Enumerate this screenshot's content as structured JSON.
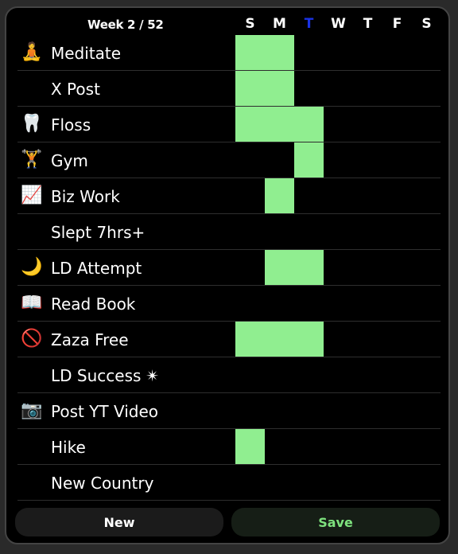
{
  "header": {
    "week_label": "Week 2 / 52",
    "days": [
      "S",
      "M",
      "T",
      "W",
      "T",
      "F",
      "S"
    ],
    "today_index": 2,
    "today_color": "#1a33e6"
  },
  "habits": [
    {
      "name": "Meditate",
      "icon": "🧘",
      "icon_name": "meditation-icon",
      "done": [
        1,
        1,
        0,
        0,
        0,
        0,
        0
      ]
    },
    {
      "name": "X Post",
      "icon": "🗣",
      "icon_name": "speaking-head-icon",
      "done": [
        1,
        1,
        0,
        0,
        0,
        0,
        0
      ]
    },
    {
      "name": "Floss",
      "icon": "🦷",
      "icon_name": "tooth-icon",
      "done": [
        1,
        1,
        1,
        0,
        0,
        0,
        0
      ]
    },
    {
      "name": "Gym",
      "icon": "🏋",
      "icon_name": "weightlifter-icon",
      "done": [
        0,
        0,
        1,
        0,
        0,
        0,
        0
      ]
    },
    {
      "name": "Biz Work",
      "icon": "📈",
      "icon_name": "chart-increasing-icon",
      "done": [
        0,
        1,
        0,
        0,
        0,
        0,
        0
      ]
    },
    {
      "name": "Slept 7hrs+",
      "icon": "😴",
      "icon_name": "sleeping-face-icon",
      "done": [
        0,
        0,
        0,
        0,
        0,
        0,
        0
      ]
    },
    {
      "name": "LD Attempt",
      "icon": "🌙",
      "icon_name": "crescent-moon-icon",
      "done": [
        0,
        1,
        1,
        0,
        0,
        0,
        0
      ]
    },
    {
      "name": "Read Book",
      "icon": "📖",
      "icon_name": "open-book-icon",
      "done": [
        0,
        0,
        0,
        0,
        0,
        0,
        0
      ]
    },
    {
      "name": "Zaza Free",
      "icon": "🚫",
      "icon_name": "prohibited-icon",
      "done": [
        1,
        1,
        1,
        0,
        0,
        0,
        0
      ]
    },
    {
      "name": "LD Success",
      "icon": "✴",
      "icon_name": "sparkle-star-icon",
      "trailing_icon": "✴",
      "done": [
        0,
        0,
        0,
        0,
        0,
        0,
        0
      ]
    },
    {
      "name": "Post YT Video",
      "icon": "📷",
      "icon_name": "camera-icon",
      "done": [
        0,
        0,
        0,
        0,
        0,
        0,
        0
      ]
    },
    {
      "name": "Hike",
      "icon": "⛰",
      "icon_name": "mountain-icon",
      "done": [
        1,
        0,
        0,
        0,
        0,
        0,
        0
      ]
    },
    {
      "name": "New Country",
      "icon": "✈",
      "icon_name": "airplane-icon",
      "done": [
        0,
        0,
        0,
        0,
        0,
        0,
        0
      ]
    }
  ],
  "done_color": "#90ee90",
  "buttons": {
    "new": "New",
    "save": "Save"
  }
}
